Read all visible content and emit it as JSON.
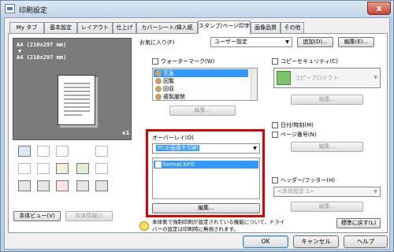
{
  "window": {
    "title": "印刷設定",
    "close": "x"
  },
  "tabs": [
    "My タブ",
    "基本設定",
    "レイアウト",
    "仕上げ",
    "カバーシート/挿入紙",
    "スタンプ/ページ印字",
    "画像品質",
    "その他"
  ],
  "preview": {
    "line1": "A4 (210x297 mm)",
    "arrow": "▼",
    "line2": "A4 (210x297 mm)",
    "copies": "x1"
  },
  "left_buttons": {
    "view": "本体ビュー(V)",
    "info": "本体情報(I)"
  },
  "favorites": {
    "label": "お気に入り(F)",
    "value": "ユーザー設定",
    "add": "追加(D)...",
    "edit": "編集(E)..."
  },
  "watermark": {
    "label": "ウォーターマーク(W)",
    "items": [
      "至急",
      "回覧",
      "回収",
      "複製厳禁"
    ],
    "edit": "編集..."
  },
  "overlay": {
    "label": "オーバーレイ(O)",
    "value": "PCの画像を印刷",
    "item": "format.KFO",
    "edit": "編集..."
  },
  "copy_security": {
    "label": "コピーセキュリティ(C)",
    "value": "コピープロテクト",
    "edit": "編集..."
  },
  "date": {
    "label": "日付/時刻(M)"
  },
  "page_number": {
    "label": "ページ番号(N)",
    "edit": "編集..."
  },
  "header_footer": {
    "label": "ヘッダー/フッター(H)",
    "value": "<本体設定 1>",
    "edit": "編集..."
  },
  "notice": {
    "text1": "本体側で強制印刷が設定されている機能について、ドライ",
    "text2": "バーの設定は印刷時に無視されます。",
    "defaults": "標準に戻す(L)"
  },
  "footer": {
    "ok": "OK",
    "cancel": "キャンセル",
    "help": "ヘルプ"
  }
}
